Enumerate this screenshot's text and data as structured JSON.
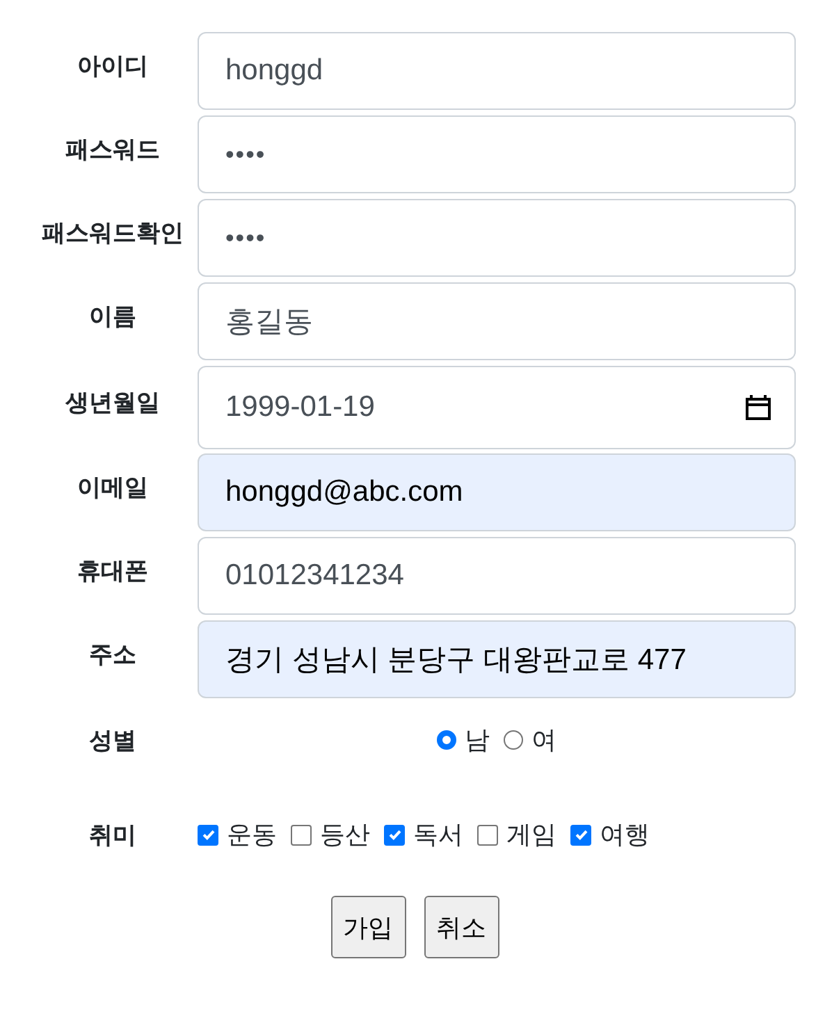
{
  "fields": [
    {
      "label": "아이디",
      "kind": "text",
      "value": "honggd",
      "autofilled": false
    },
    {
      "label": "패스워드",
      "kind": "password",
      "value": "••••",
      "autofilled": false
    },
    {
      "label": "패스워드확인",
      "kind": "password",
      "value": "••••",
      "autofilled": false
    },
    {
      "label": "이름",
      "kind": "text",
      "value": "홍길동",
      "autofilled": false
    },
    {
      "label": "생년월일",
      "kind": "date",
      "value": "1999-01-19",
      "autofilled": false
    },
    {
      "label": "이메일",
      "kind": "text",
      "value": "honggd@abc.com",
      "autofilled": true
    },
    {
      "label": "휴대폰",
      "kind": "text",
      "value": "01012341234",
      "autofilled": false
    },
    {
      "label": "주소",
      "kind": "text",
      "value": "경기 성남시 분당구 대왕판교로 477",
      "autofilled": true
    }
  ],
  "gender": {
    "label": "성별",
    "options": [
      {
        "label": "남",
        "selected": true
      },
      {
        "label": "여",
        "selected": false
      }
    ]
  },
  "hobbies": {
    "label": "취미",
    "options": [
      {
        "label": "운동",
        "checked": true
      },
      {
        "label": "등산",
        "checked": false
      },
      {
        "label": "독서",
        "checked": true
      },
      {
        "label": "게임",
        "checked": false
      },
      {
        "label": "여행",
        "checked": true
      }
    ]
  },
  "buttons": [
    "가입",
    "취소"
  ]
}
